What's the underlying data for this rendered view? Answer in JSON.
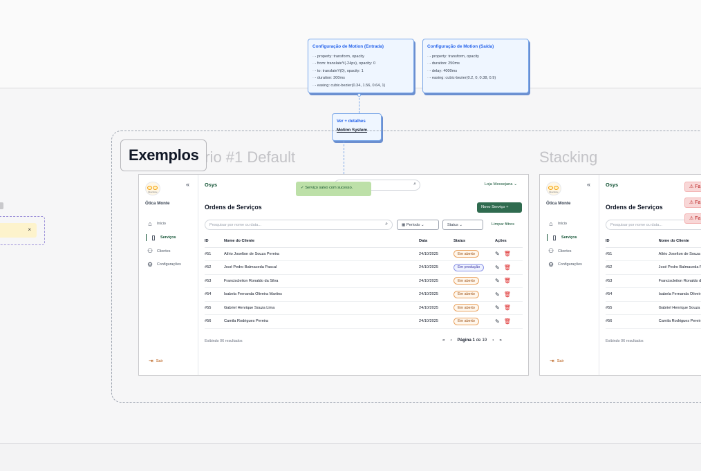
{
  "annotations": {
    "motion_in": {
      "title": "Configuração de Motion (Entrada)",
      "lines": [
        "- property: transform, opacity",
        "- from: translateY(-24px), opacity: 0",
        "- to: translateY(0), opacity: 1",
        "- duration: 300ms",
        "- easing: cubic-bezier(0.34, 1.56, 0.64, 1)"
      ]
    },
    "motion_out": {
      "title": "Configuração de Motion (Saída)",
      "lines": [
        "- property: transform, opacity",
        "- duration: 250ms",
        "- delay: 4000ms",
        "- easing: cubic-bezier(0.2, 0, 0.38, 0.9)"
      ]
    },
    "details": {
      "title": "Ver + detalhes",
      "link": "Motion System"
    }
  },
  "section": {
    "label": "Exemplos",
    "frame1_title": "ário #1 Default",
    "frame2_title": "Stacking"
  },
  "app": {
    "brand": "Osys",
    "logo_caption": "Ótica Monte",
    "store_name": "Ótica Monte",
    "collapse_icon": "«",
    "nav": [
      {
        "label": "Início",
        "icon": "home-icon"
      },
      {
        "label": "Serviços",
        "icon": "file-icon",
        "active": true
      },
      {
        "label": "Clientes",
        "icon": "users-icon"
      },
      {
        "label": "Configurações",
        "icon": "gear-icon"
      }
    ],
    "logout": "Sair",
    "store_selector": "Loja Messejana",
    "toast": "Serviço salvo com sucesso.",
    "page_title": "Ordens de Serviços",
    "new_button": "Novo Serviço",
    "search_placeholder": "Pesquisar por nome ou data...",
    "period_label": "Período",
    "status_label": "Status",
    "clear_filters": "Limpar filtros",
    "columns": {
      "id": "ID",
      "name": "Nome do Cliente",
      "date": "Data",
      "status": "Status",
      "actions": "Ações"
    },
    "rows": [
      {
        "id": "#51",
        "name": "Alírio Joselton de Souza Pereira",
        "date": "24/10/2025",
        "status": "Em aberto",
        "kind": "aberto"
      },
      {
        "id": "#52",
        "name": "José Pedro Balmaceda Pascal",
        "date": "24/10/2025",
        "status": "Em produção",
        "kind": "producao"
      },
      {
        "id": "#53",
        "name": "Franciscleiton Ronaldo da Silva",
        "date": "24/10/2025",
        "status": "Em aberto",
        "kind": "aberto"
      },
      {
        "id": "#54",
        "name": "Isabela Fernanda Oliveira Martins",
        "date": "24/10/2025",
        "status": "Em aberto",
        "kind": "aberto"
      },
      {
        "id": "#55",
        "name": "Gabriel Henrique Souza Lima",
        "date": "24/10/2025",
        "status": "Em aberto",
        "kind": "aberto"
      },
      {
        "id": "#56",
        "name": "Camila Rodrigues Pereira",
        "date": "24/10/2025",
        "status": "Em aberto",
        "kind": "aberto"
      }
    ],
    "results": "Exibindo 06 resultados",
    "page_label": "Página",
    "page_current": "1",
    "page_of": "de",
    "page_total": "19"
  },
  "stacking_alerts": [
    "Fa",
    "Fa",
    "Fa"
  ],
  "left_toast_close": "×",
  "colors": {
    "primary": "#2f6b4f",
    "toast_success": "#bde0a8",
    "danger": "#dc2626",
    "annotation": "#2563eb"
  }
}
